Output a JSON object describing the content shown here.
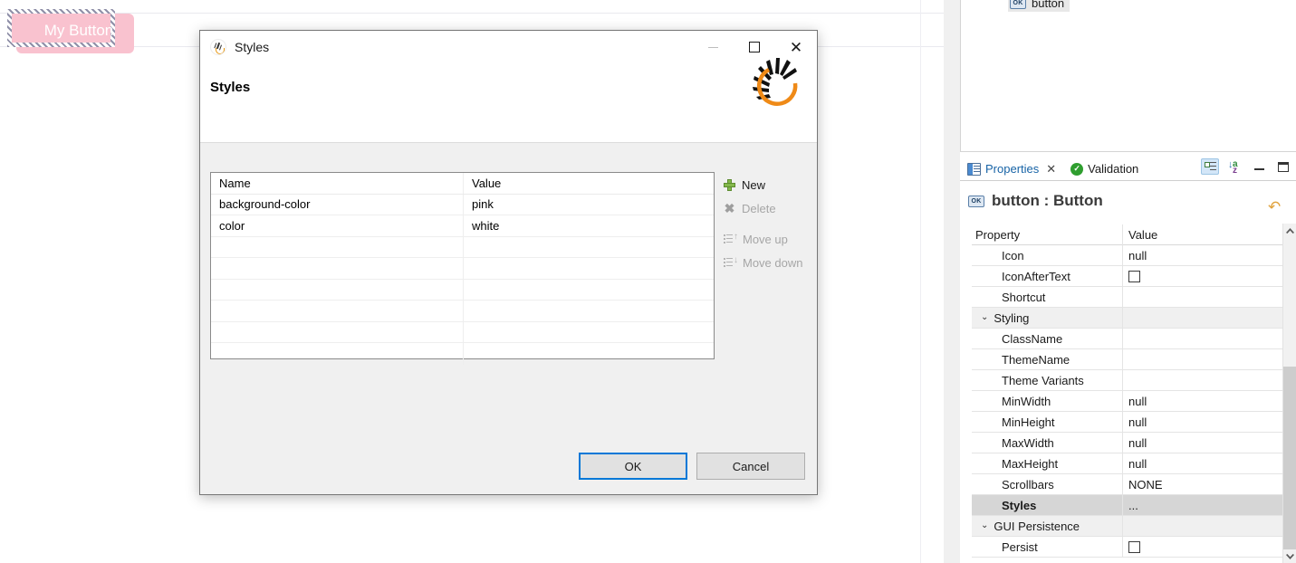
{
  "canvas": {
    "preview_button_label": "My Button",
    "preview_button_bg": "#f9c2cf",
    "preview_button_color": "#ffffff"
  },
  "tree": {
    "item_label": "button",
    "item_icon": "ok-icon"
  },
  "panel": {
    "tabs": [
      {
        "label": "Properties",
        "icon": "properties-icon",
        "active": true,
        "closeable": true
      },
      {
        "label": "Validation",
        "icon": "validation-check-icon",
        "active": false,
        "closeable": false
      }
    ],
    "close_glyph": "✕",
    "toolbar": [
      {
        "name": "show-categories-toggle",
        "icon": "tree-categories-icon",
        "active": true
      },
      {
        "name": "sort-alphabetically-button",
        "icon": "sort-az-icon",
        "active": false
      },
      {
        "name": "minimize-panel-button",
        "icon": "minimize-icon",
        "active": false
      },
      {
        "name": "maximize-panel-button",
        "icon": "maximize-icon",
        "active": false
      }
    ],
    "title": "button : Button",
    "title_icon": "ok-icon",
    "restore_icon": "↶",
    "sort_a": "a",
    "sort_z": "z",
    "sort_arrow": "↓",
    "grid": {
      "headers": [
        "Property",
        "Value"
      ],
      "rows": [
        {
          "name": "Icon",
          "value": "null",
          "type": "text",
          "indent": true
        },
        {
          "name": "IconAfterText",
          "value": "",
          "type": "checkbox",
          "indent": true,
          "checked": false
        },
        {
          "name": "Shortcut",
          "value": "",
          "type": "text",
          "indent": true
        },
        {
          "name": "Styling",
          "value": "",
          "type": "group",
          "expanded": true
        },
        {
          "name": "ClassName",
          "value": "",
          "type": "text",
          "indent": true
        },
        {
          "name": "ThemeName",
          "value": "",
          "type": "text",
          "indent": true
        },
        {
          "name": "Theme Variants",
          "value": "",
          "type": "text",
          "indent": true
        },
        {
          "name": "MinWidth",
          "value": "null",
          "type": "text",
          "indent": true
        },
        {
          "name": "MinHeight",
          "value": "null",
          "type": "text",
          "indent": true
        },
        {
          "name": "MaxWidth",
          "value": "null",
          "type": "text",
          "indent": true
        },
        {
          "name": "MaxHeight",
          "value": "null",
          "type": "text",
          "indent": true
        },
        {
          "name": "Scrollbars",
          "value": "NONE",
          "type": "text",
          "indent": true
        },
        {
          "name": "Styles",
          "value": "...",
          "type": "text",
          "indent": true,
          "selected": true
        },
        {
          "name": "GUI Persistence",
          "value": "",
          "type": "group",
          "expanded": true
        },
        {
          "name": "Persist",
          "value": "",
          "type": "checkbox",
          "indent": true,
          "checked": false
        }
      ],
      "chevron_expanded": "⌄"
    }
  },
  "dialog": {
    "window_title": "Styles",
    "header_title": "Styles",
    "window_buttons": {
      "minimize": "—",
      "maximize": "□",
      "close": "✕"
    },
    "table": {
      "headers": [
        "Name",
        "Value"
      ],
      "rows": [
        {
          "name": "background-color",
          "value": "pink"
        },
        {
          "name": "color",
          "value": "white"
        },
        {
          "name": "",
          "value": ""
        },
        {
          "name": "",
          "value": ""
        },
        {
          "name": "",
          "value": ""
        },
        {
          "name": "",
          "value": ""
        },
        {
          "name": "",
          "value": ""
        },
        {
          "name": "",
          "value": ""
        }
      ]
    },
    "actions": [
      {
        "label": "New",
        "icon": "plus-icon",
        "enabled": true
      },
      {
        "label": "Delete",
        "icon": "x-icon",
        "enabled": false
      },
      {
        "label": "Move up",
        "icon": "move-up-icon",
        "enabled": false
      },
      {
        "label": "Move down",
        "icon": "move-down-icon",
        "enabled": false
      }
    ],
    "buttons": {
      "ok": "OK",
      "cancel": "Cancel"
    },
    "accent_focus_color": "#0078d7"
  },
  "scrollbars": {
    "up_glyph": "⌃",
    "down_glyph": "⌄"
  }
}
